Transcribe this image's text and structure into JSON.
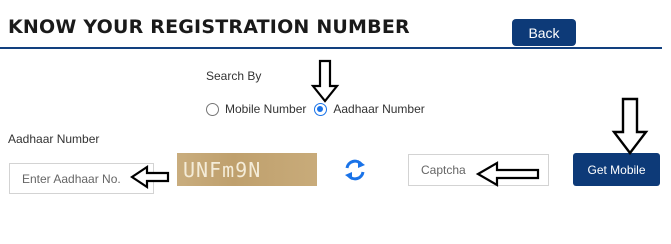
{
  "header": {
    "title": "KNOW YOUR REGISTRATION NUMBER",
    "back_label": "Back"
  },
  "search": {
    "label": "Search By",
    "options": [
      {
        "label": "Mobile Number",
        "checked": false
      },
      {
        "label": "Aadhaar Number",
        "checked": true
      }
    ]
  },
  "form": {
    "aadhaar_label": "Aadhaar Number",
    "aadhaar_placeholder": "Enter Aadhaar No.",
    "captcha_text": "UNFm9N",
    "captcha_placeholder": "Captcha",
    "submit_label": "Get Mobile"
  },
  "icons": {
    "refresh": "refresh-icon",
    "annotation_arrows": "arrow-icon"
  },
  "colors": {
    "primary": "#0d3a78",
    "radio_accent": "#1a73e8",
    "captcha_bg": "#c4a675"
  }
}
